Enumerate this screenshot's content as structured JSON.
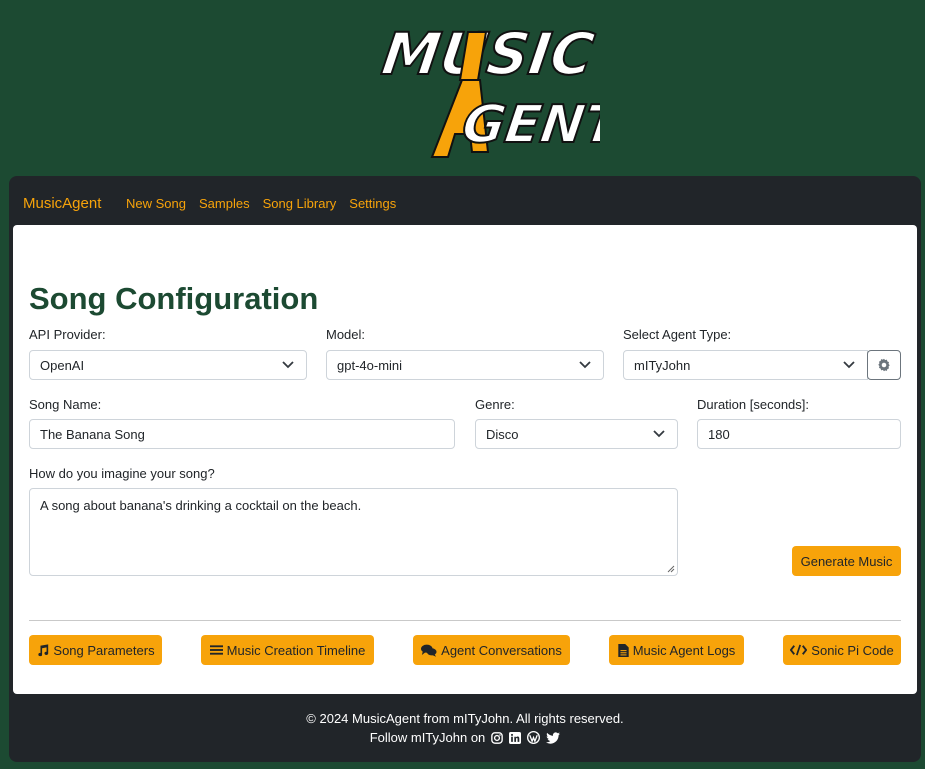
{
  "logo": {
    "line1": "MUSIC",
    "line2": "AGENT",
    "accent": "AI"
  },
  "navbar": {
    "brand": "MusicAgent",
    "links": [
      "New Song",
      "Samples",
      "Song Library",
      "Settings"
    ]
  },
  "form": {
    "title": "Song Configuration",
    "api_provider": {
      "label": "API Provider:",
      "value": "OpenAI"
    },
    "model": {
      "label": "Model:",
      "value": "gpt-4o-mini"
    },
    "agent_type": {
      "label": "Select Agent Type:",
      "value": "mITyJohn"
    },
    "song_name": {
      "label": "Song Name:",
      "value": "The Banana Song"
    },
    "genre": {
      "label": "Genre:",
      "value": "Disco"
    },
    "duration": {
      "label": "Duration [seconds]:",
      "value": "180"
    },
    "imagine": {
      "label": "How do you imagine your song?",
      "value": "A song about banana's drinking a cocktail on the beach."
    },
    "generate_label": "Generate Music"
  },
  "tabs": {
    "song_parameters": "Song Parameters",
    "timeline": "Music Creation Timeline",
    "conversations": "Agent Conversations",
    "logs": "Music Agent Logs",
    "sonic_pi": "Sonic Pi Code"
  },
  "footer": {
    "copyright": "© 2024 MusicAgent from mITyJohn. All rights reserved.",
    "follow": "Follow mITyJohn on"
  },
  "colors": {
    "background": "#1c4a32",
    "accent": "#f7a30a",
    "dark": "#212529"
  },
  "icons": [
    "music-note-icon",
    "list-icon",
    "chat-icon",
    "file-icon",
    "code-icon",
    "gear-icon",
    "chevron-down-icon",
    "instagram-icon",
    "linkedin-icon",
    "wordpress-icon",
    "twitter-icon"
  ]
}
